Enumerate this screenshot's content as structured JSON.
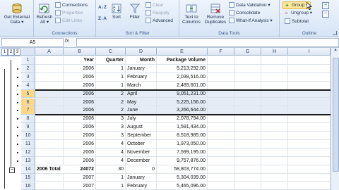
{
  "ribbon": {
    "get_external": "Get External\nData ▾",
    "refresh_all": "Refresh\nAll ▾",
    "connections": "Connections",
    "properties": "Properties",
    "edit_links": "Edit Links",
    "connections_group": "Connections",
    "sort_az": "A↓Z",
    "sort_za": "Z↓A",
    "sort": "Sort",
    "filter": "Filter",
    "clear": "Clear",
    "reapply": "Reapply",
    "advanced": "Advanced",
    "sort_filter_group": "Sort & Filter",
    "text_to_columns": "Text to\nColumns",
    "remove_duplicates": "Remove\nDuplicates",
    "data_validation": "Data Validation ▾",
    "consolidate": "Consolidate",
    "what_if": "What-If Analysis ▾",
    "data_tools_group": "Data Tools",
    "group": "Group ▾",
    "ungroup": "Ungroup ▾",
    "subtotal": "Subtotal",
    "outline_group": "Outline"
  },
  "formula_bar": {
    "name_box": "A5",
    "fx": "fx",
    "value": ""
  },
  "outline_levels": [
    "1",
    "2",
    "3"
  ],
  "columns": [
    "A",
    "B",
    "C",
    "D",
    "E",
    "F",
    "G",
    "H",
    "I"
  ],
  "rows": [
    {
      "n": "1",
      "a": "",
      "b": "Year",
      "c": "Quarter",
      "d": "Month",
      "e": "Package Volume"
    },
    {
      "n": "2",
      "a": "",
      "b": "2006",
      "c": "1",
      "d": "January",
      "e": "5,213,292.00"
    },
    {
      "n": "3",
      "a": "",
      "b": "2006",
      "c": "1",
      "d": "February",
      "e": "2,038,516.00"
    },
    {
      "n": "4",
      "a": "",
      "b": "2006",
      "c": "1",
      "d": "March",
      "e": "2,489,601.00"
    },
    {
      "n": "5",
      "a": "",
      "b": "2006",
      "c": "2",
      "d": "April",
      "e": "9,051,231.00"
    },
    {
      "n": "6",
      "a": "",
      "b": "2006",
      "c": "2",
      "d": "May",
      "e": "5,225,156.00"
    },
    {
      "n": "7",
      "a": "",
      "b": "2006",
      "c": "2",
      "d": "June",
      "e": "3,266,644.00"
    },
    {
      "n": "8",
      "a": "",
      "b": "2006",
      "c": "3",
      "d": "July",
      "e": "2,078,794.00"
    },
    {
      "n": "9",
      "a": "",
      "b": "2006",
      "c": "3",
      "d": "August",
      "e": "1,591,434.00"
    },
    {
      "n": "10",
      "a": "",
      "b": "2006",
      "c": "3",
      "d": "September",
      "e": "8,518,985.00"
    },
    {
      "n": "11",
      "a": "",
      "b": "2006",
      "c": "4",
      "d": "October",
      "e": "1,973,050.00"
    },
    {
      "n": "12",
      "a": "",
      "b": "2006",
      "c": "4",
      "d": "November",
      "e": "7,599,195.00"
    },
    {
      "n": "13",
      "a": "",
      "b": "2006",
      "c": "4",
      "d": "December",
      "e": "9,757,876.00"
    },
    {
      "n": "14",
      "a": "2006 Total",
      "b": "24072",
      "c": "30",
      "d": "0",
      "e": "58,803,774.00"
    },
    {
      "n": "15",
      "a": "",
      "b": "2007",
      "c": "1",
      "d": "January",
      "e": "5,304,039.00"
    },
    {
      "n": "16",
      "a": "",
      "b": "2007",
      "c": "1",
      "d": "February",
      "e": "5,465,096.00"
    }
  ]
}
